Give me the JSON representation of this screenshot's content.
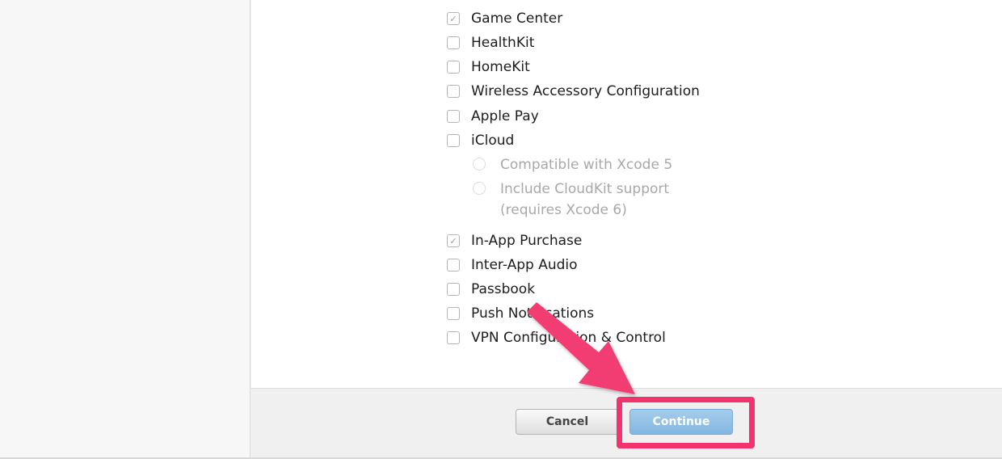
{
  "capabilities": {
    "items": [
      {
        "label": "Game Center",
        "checked": true
      },
      {
        "label": "HealthKit",
        "checked": false
      },
      {
        "label": "HomeKit",
        "checked": false
      },
      {
        "label": "Wireless Accessory Configuration",
        "checked": false
      },
      {
        "label": "Apple Pay",
        "checked": false
      },
      {
        "label": "iCloud",
        "checked": false
      },
      {
        "label": "In-App Purchase",
        "checked": true
      },
      {
        "label": "Inter-App Audio",
        "checked": false
      },
      {
        "label": "Passbook",
        "checked": false
      },
      {
        "label": "Push Notifications",
        "checked": false
      },
      {
        "label": "VPN Configuration & Control",
        "checked": false
      }
    ],
    "icloud_options": [
      {
        "label": "Compatible with Xcode 5",
        "enabled": false
      },
      {
        "label": "Include CloudKit support",
        "label2": "(requires Xcode 6)",
        "enabled": false
      }
    ]
  },
  "footer": {
    "cancel_label": "Cancel",
    "continue_label": "Continue"
  },
  "annotation": {
    "highlight_color": "#f2336d",
    "arrow_color": "#f23d73"
  },
  "icons": {
    "check": "checkmark-icon"
  }
}
